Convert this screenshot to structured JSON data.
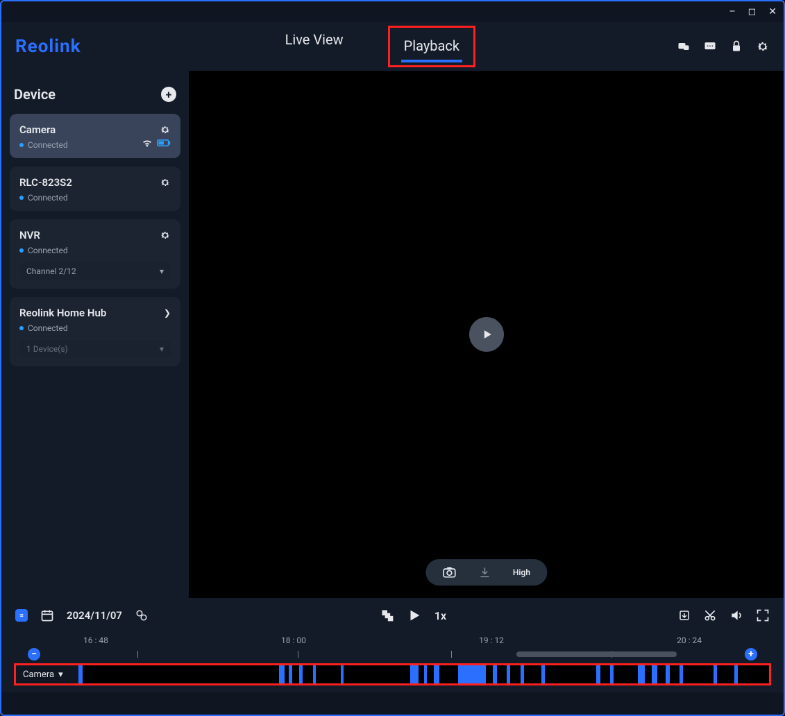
{
  "brand": "Reolink",
  "window_controls": {
    "minimize": "–",
    "maximize": "◻",
    "close": "✕"
  },
  "tabs": {
    "live": "Live View",
    "playback": "Playback"
  },
  "active_tab": "playback",
  "sidebar": {
    "title": "Device",
    "devices": [
      {
        "name": "Camera",
        "status": "Connected",
        "has_wifi": true,
        "has_battery": true,
        "selected": true
      },
      {
        "name": "RLC-823S2",
        "status": "Connected"
      },
      {
        "name": "NVR",
        "status": "Connected",
        "sub_label": "Channel 2/12"
      },
      {
        "name": "Reolink Home Hub",
        "status": "Connected",
        "expandable": true,
        "sub_label": "1 Device(s)"
      }
    ]
  },
  "viewer_toolbar": {
    "quality": "High"
  },
  "controls": {
    "date": "2024/11/07",
    "speed": "1x"
  },
  "timeline": {
    "labels": [
      "16 : 48",
      "18 : 00",
      "19 : 12",
      "20 : 24"
    ],
    "zoom_out": "−",
    "zoom_in": "+",
    "track_name": "Camera"
  }
}
